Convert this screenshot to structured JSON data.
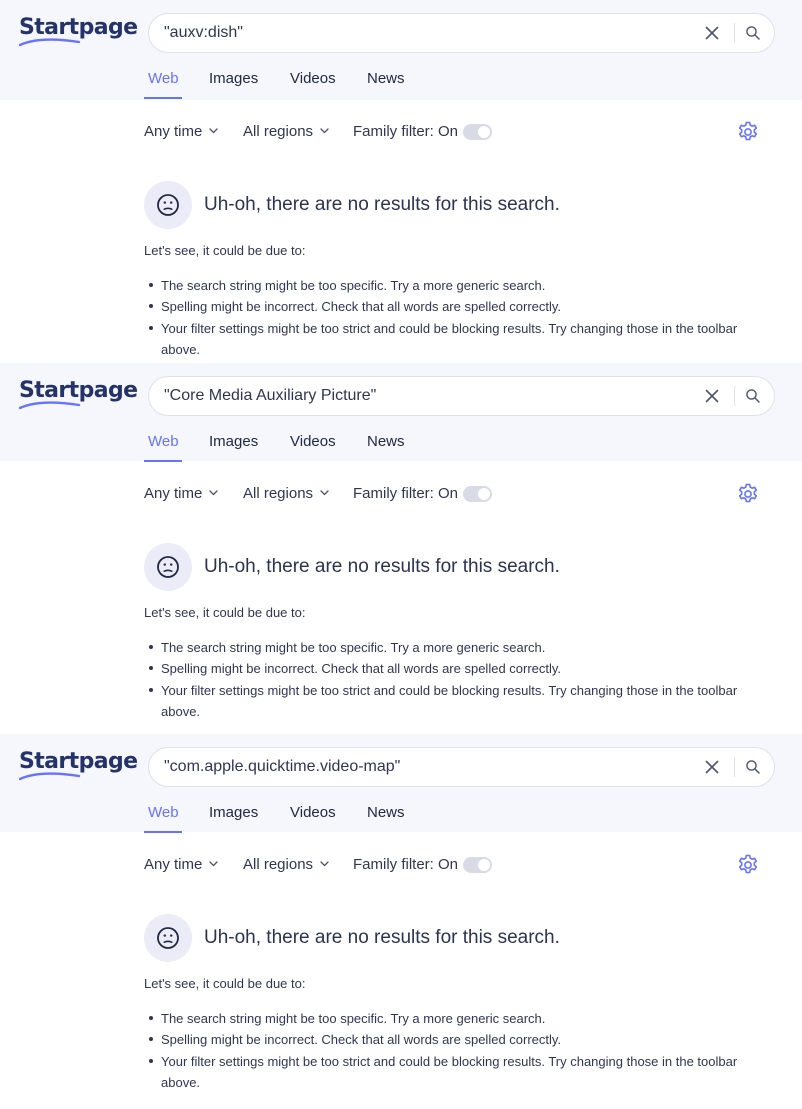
{
  "brand": {
    "logo_text": "Startpage",
    "accent": "#6573ff",
    "logo_color": "#25336b"
  },
  "tabs": [
    "Web",
    "Images",
    "Videos",
    "News"
  ],
  "active_tab": "Web",
  "filters": {
    "time": "Any time",
    "region": "All regions",
    "family": "Family filter: On",
    "family_on": true
  },
  "icons": {
    "clear": "close-icon",
    "search": "search-icon",
    "settings": "gear-icon",
    "face": "confused-face-icon",
    "dropdown": "chevron-down-icon"
  },
  "panels": [
    {
      "query": "\"auxv:dish\""
    },
    {
      "query": "\"Core Media Auxiliary Picture\""
    },
    {
      "query": "\"com.apple.quicktime.video-map\""
    }
  ],
  "message": {
    "title": "Uh-oh, there are no results for this search.",
    "intro": "Let's see, it could be due to:",
    "reasons": [
      "The search string might be too specific. Try a more generic search.",
      "Spelling might be incorrect. Check that all words are spelled correctly.",
      "Your filter settings might be too strict and could be blocking results. Try changing those in the toolbar above."
    ]
  }
}
